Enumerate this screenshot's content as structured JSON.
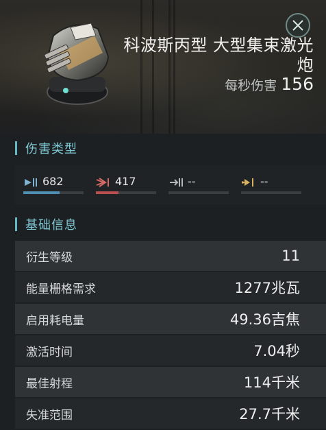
{
  "item": {
    "name": "科波斯丙型 大型集束激光炮",
    "dps_label": "每秒伤害",
    "dps_value": "156"
  },
  "damage_section": {
    "title": "伤害类型",
    "types": [
      {
        "name": "em-damage-icon",
        "value": "682",
        "fill_fraction": 0.6,
        "color": "#4f8fb4"
      },
      {
        "name": "thermal-damage-icon",
        "value": "417",
        "fill_fraction": 0.37,
        "color": "#b8504f"
      },
      {
        "name": "kinetic-damage-icon",
        "value": "--",
        "fill_fraction": 0,
        "color": "#8a8f92"
      },
      {
        "name": "explosive-damage-icon",
        "value": "--",
        "fill_fraction": 0,
        "color": "#b59a56"
      }
    ]
  },
  "basic_section": {
    "title": "基础信息",
    "rows": [
      {
        "label": "衍生等级",
        "value": "11"
      },
      {
        "label": "能量栅格需求",
        "value": "1277兆瓦"
      },
      {
        "label": "启用耗电量",
        "value": "49.36吉焦"
      },
      {
        "label": "激活时间",
        "value": "7.04秒"
      },
      {
        "label": "最佳射程",
        "value": "114千米"
      },
      {
        "label": "失准范围",
        "value": "27.7千米"
      }
    ]
  },
  "colors": {
    "accent": "#7ec7d3",
    "background": "#1d2022"
  }
}
